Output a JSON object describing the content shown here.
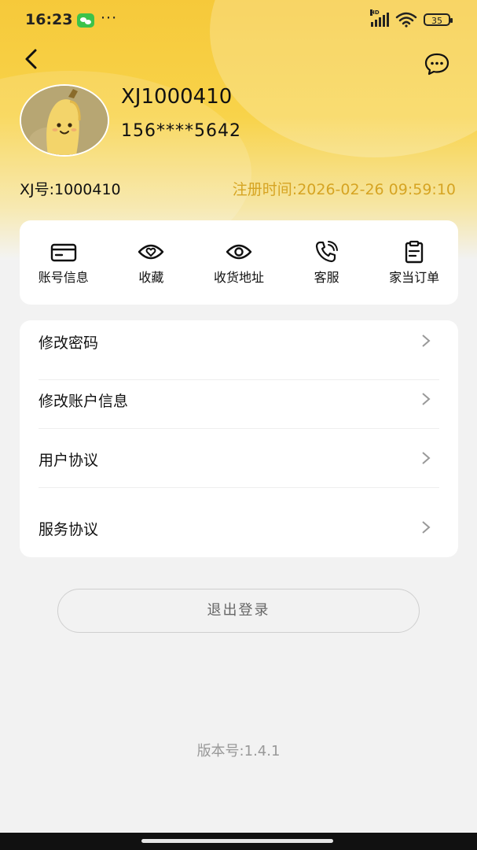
{
  "status_bar": {
    "time": "16:23",
    "dots": "···",
    "hd": "HD",
    "battery": "35"
  },
  "profile": {
    "username": "XJ1000410",
    "phone": "156****5642",
    "xj_number": "XJ号:1000410",
    "register_time": "注册时间:2026-02-26 09:59:10"
  },
  "quick_actions": [
    {
      "label": "账号信息",
      "icon": "card-icon"
    },
    {
      "label": "收藏",
      "icon": "heart-eye-icon"
    },
    {
      "label": "收货地址",
      "icon": "location-icon"
    },
    {
      "label": "客服",
      "icon": "phone-icon"
    },
    {
      "label": "家当订单",
      "icon": "clipboard-icon"
    }
  ],
  "menu": [
    {
      "label": "修改密码"
    },
    {
      "label": "修改账户信息"
    },
    {
      "label": "用户协议"
    },
    {
      "label": "服务协议"
    }
  ],
  "logout_label": "退出登录",
  "version": "版本号:1.4.1",
  "colors": {
    "accent": "#f6c93a",
    "register_time": "#d6a422",
    "background": "#f2f2f2"
  }
}
